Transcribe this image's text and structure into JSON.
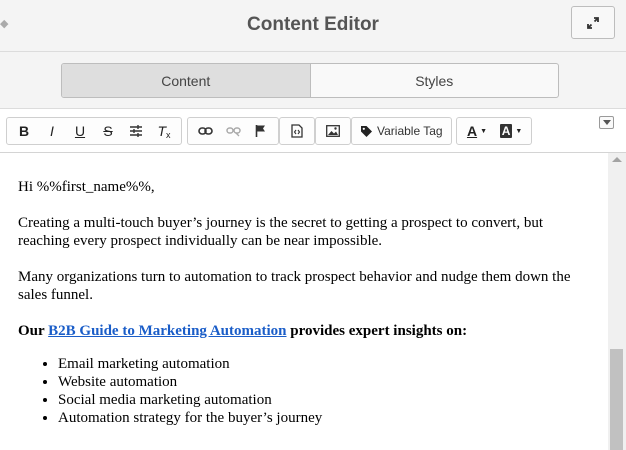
{
  "header": {
    "title": "Content Editor",
    "expand_icon": "expand-arrows-icon",
    "drag_icon": "drag-handle-icon"
  },
  "tabs": [
    {
      "label": "Content",
      "active": true
    },
    {
      "label": "Styles",
      "active": false
    }
  ],
  "toolbar": {
    "groups": [
      [
        "bold-icon",
        "italic-icon",
        "underline-icon",
        "strikethrough-icon",
        "align-icon",
        "clear-format-icon"
      ],
      [
        "link-icon",
        "unlink-icon",
        "anchor-flag-icon"
      ],
      [
        "source-code-icon"
      ],
      [
        "image-icon"
      ],
      [
        "tag-icon"
      ],
      [
        "text-color-icon",
        "background-color-icon"
      ]
    ],
    "variable_tag_label": "Variable Tag",
    "text_color_glyph": "A",
    "bg_color_glyph": "A",
    "bold_glyph": "B",
    "italic_glyph": "I",
    "underline_glyph": "U",
    "strike_glyph": "S",
    "clear_glyph": "T"
  },
  "content": {
    "greeting": "Hi %%first_name%%,",
    "para1": "Creating a multi-touch buyer’s journey is the secret to getting a prospect to convert, but reaching every prospect individually can be near impossible.",
    "para2": "Many organizations turn to automation to track prospect behavior and nudge them down the sales funnel.",
    "cta_prefix": "Our ",
    "cta_link": "B2B Guide to Marketing Automation",
    "cta_suffix": " provides expert insights on:",
    "bullets": [
      "Email marketing automation",
      "Website automation",
      "Social media marketing automation",
      "Automation strategy for the buyer’s journey"
    ]
  },
  "colors": {
    "link": "#1a5dc8",
    "header_bg": "#f4f4f4",
    "active_tab": "#dedede"
  }
}
